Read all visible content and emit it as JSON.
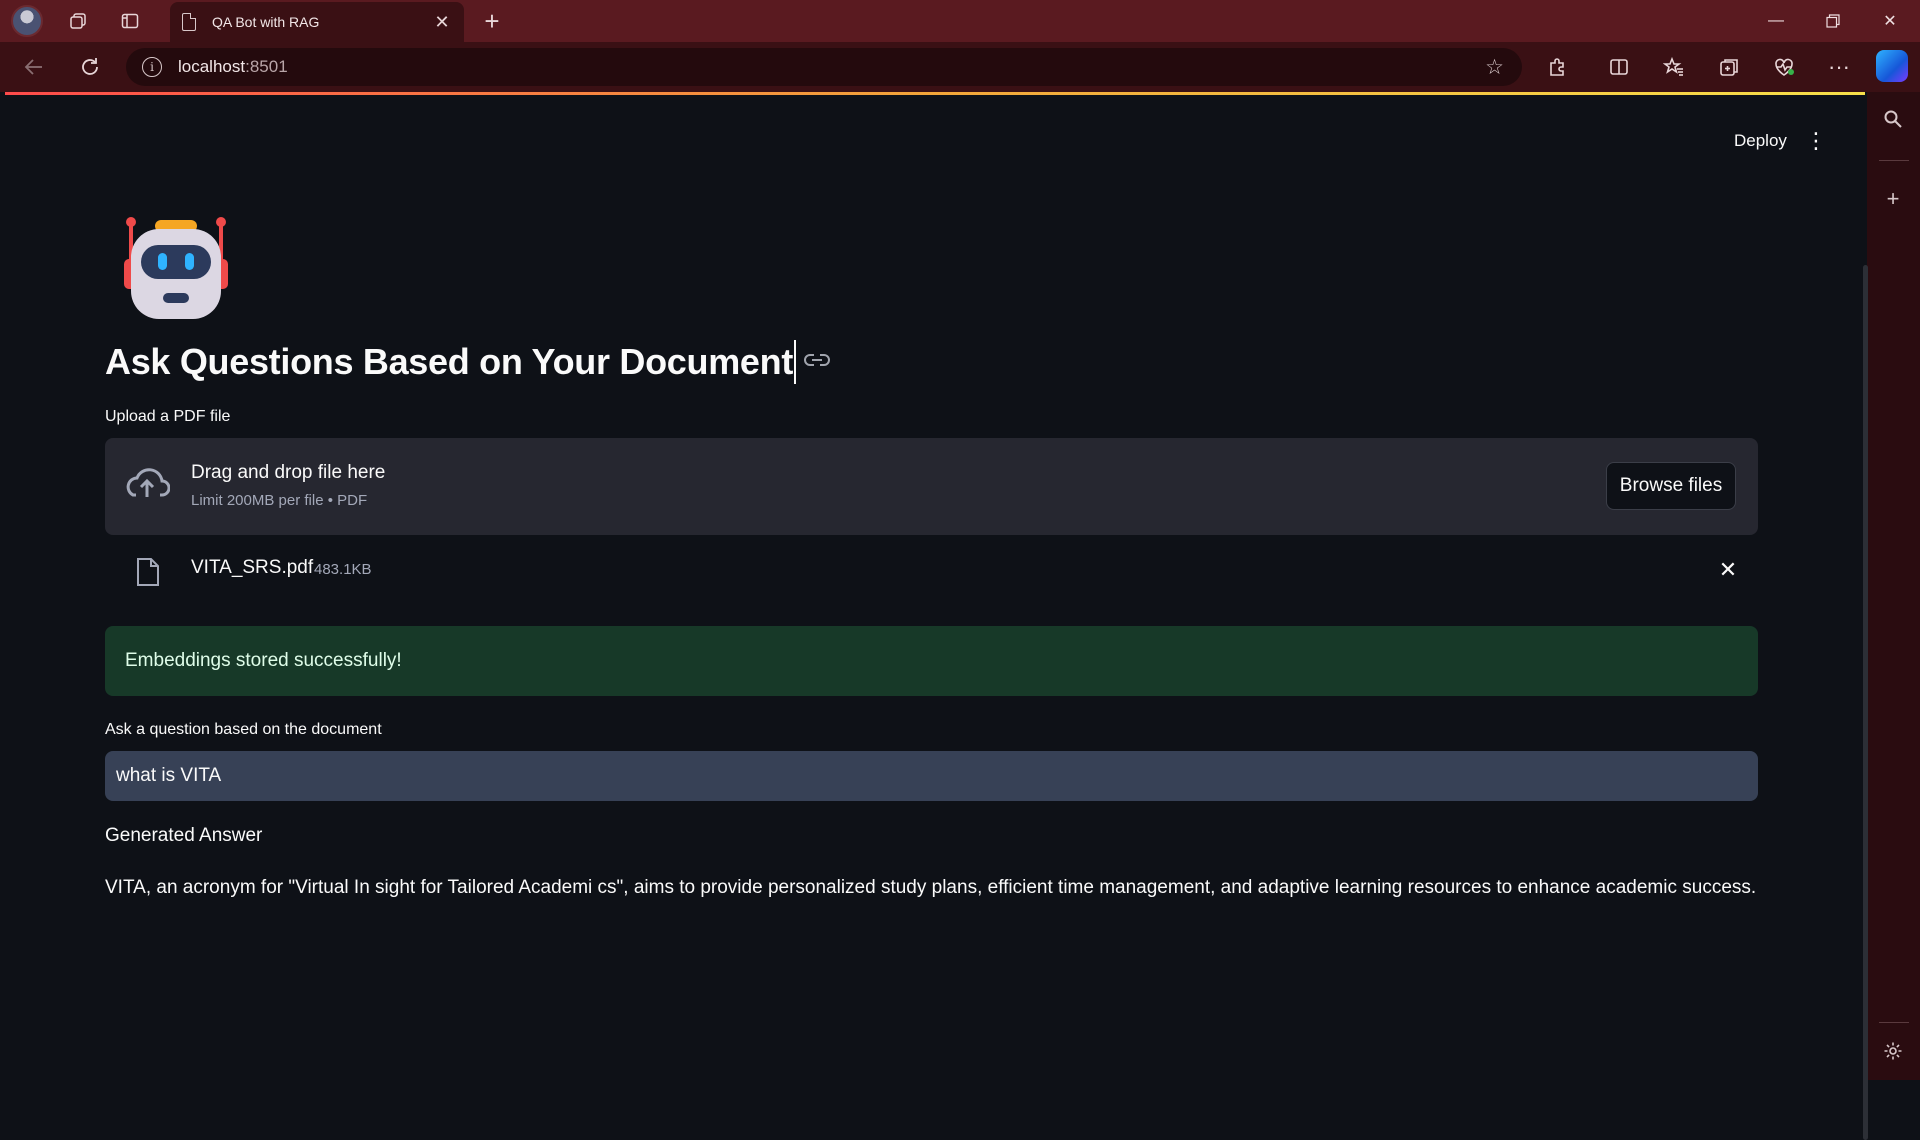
{
  "browser": {
    "tab_title": "QA Bot with RAG",
    "url_host": "localhost",
    "url_port": ":8501"
  },
  "toolbar": {
    "deploy_label": "Deploy"
  },
  "main": {
    "heading": "Ask Questions Based on Your Document",
    "upload": {
      "label": "Upload a PDF file",
      "drop_title": "Drag and drop file here",
      "drop_sub": "Limit 200MB per file • PDF",
      "browse_label": "Browse files"
    },
    "file": {
      "name": "VITA_SRS.pdf",
      "size": "483.1KB"
    },
    "success_message": "Embeddings stored successfully!",
    "question": {
      "label": "Ask a question based on the document",
      "value": "what is VITA"
    },
    "answer_heading": "Generated Answer",
    "answer_text": "VITA, an acronym for \"Virtual In sight for Tailored Academi cs\", aims to provide personalized study plans, efficient time management, and adaptive learning resources to enhance academic success."
  },
  "colors": {
    "titlebar": "#5a1a20",
    "page_bg": "#0e1117",
    "success_bg": "#173928",
    "input_bg": "#374156"
  }
}
